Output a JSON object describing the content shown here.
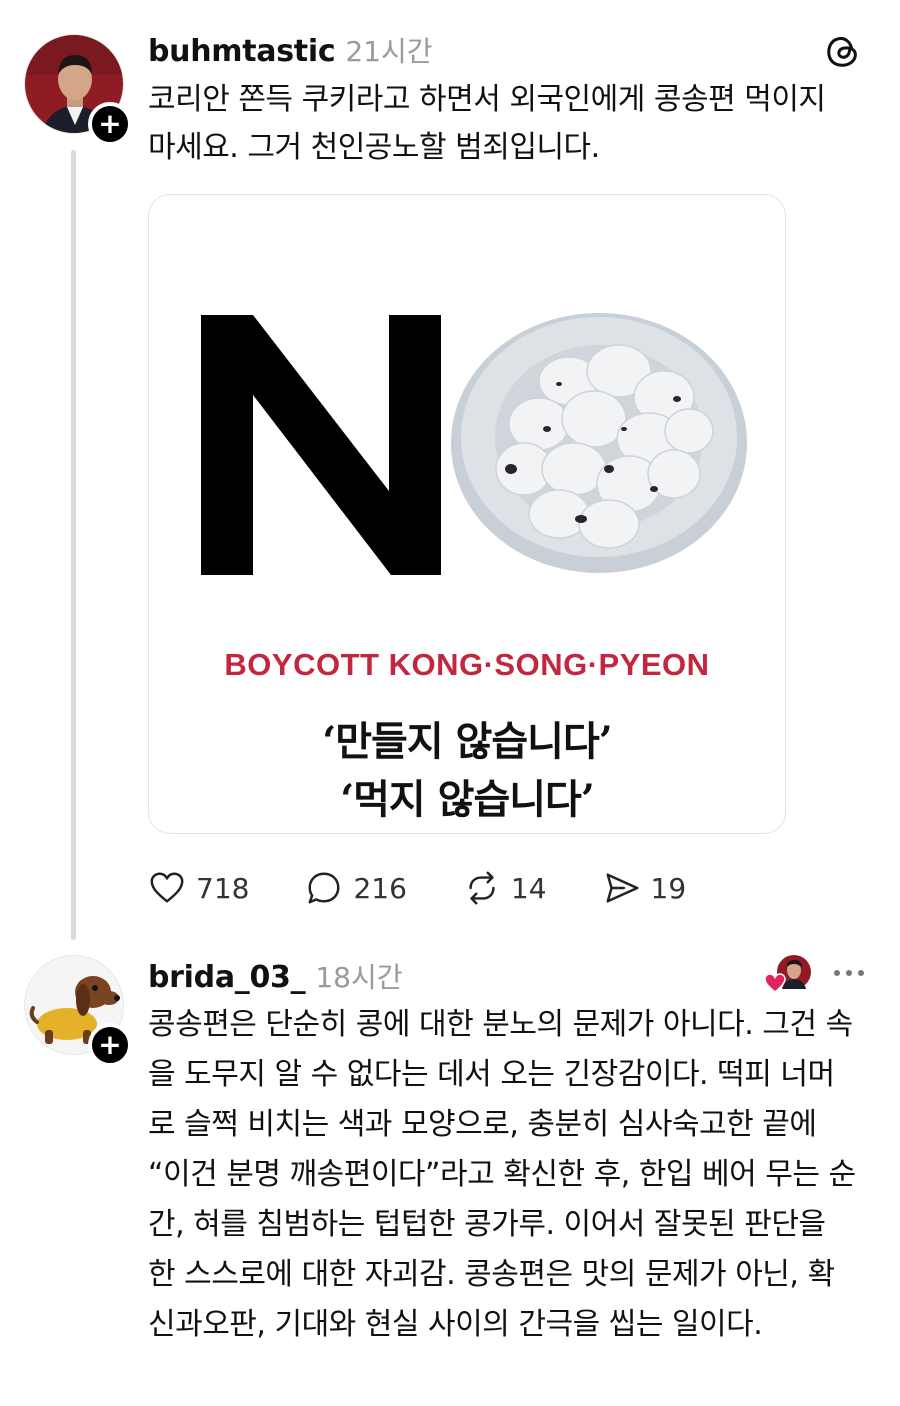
{
  "posts": [
    {
      "username": "buhmtastic",
      "timestamp": "21시간",
      "text": "코리안 쫀득 쿠키라고 하면서 외국인에게 콩송편 먹이지 마세요. 그거 천인공노할 범죄입니다.",
      "follow_symbol": "+",
      "media": {
        "boycott_text": "BOYCOTT KONG·SONG·PYEON",
        "slogan_line1": "‘만들지 않습니다’",
        "slogan_line2": "‘먹지 않습니다’"
      },
      "actions": {
        "likes": "718",
        "replies": "216",
        "reposts": "14",
        "shares": "19"
      }
    },
    {
      "username": "brida_03_",
      "timestamp": "18시간",
      "follow_symbol": "+",
      "text": "콩송편은 단순히 콩에 대한 분노의 문제가 아니다. 그건 속을 도무지 알 수 없다는 데서 오는 긴장감이다. 떡피 너머로 슬쩍 비치는 색과 모양으로, 충분히 심사숙고한 끝에 “이건 분명 깨송편이다”라고 확신한 후, 한입 베어 무는 순간, 혀를 침범하는 텁텁한 콩가루. 이어서 잘못된 판단을 한 스스로에 대한 자괴감. 콩송편은 맛의 문제가 아닌, 확신과오판, 기대와 현실 사이의 간극을 씹는 일이다."
    }
  ],
  "colors": {
    "boycott_red": "#c1273f",
    "liked_heart": "#e0245e",
    "muted_text": "#9a9a9a"
  },
  "icons": [
    "threads-logo-icon",
    "heart-icon",
    "comment-icon",
    "repost-icon",
    "share-icon",
    "more-icon",
    "follow-plus-icon"
  ]
}
